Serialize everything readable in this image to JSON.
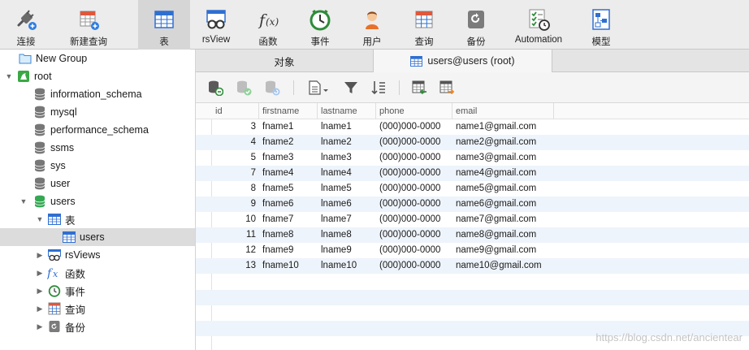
{
  "toolbar": {
    "items": [
      {
        "label": "连接",
        "icon": "connection-plug-icon"
      },
      {
        "label": "新建查询",
        "icon": "new-query-icon"
      },
      {
        "label": "表",
        "icon": "table-icon",
        "active": true
      },
      {
        "label": "rsView",
        "icon": "view-glasses-icon"
      },
      {
        "label": "函数",
        "icon": "function-fx-icon"
      },
      {
        "label": "事件",
        "icon": "event-clock-icon"
      },
      {
        "label": "用户",
        "icon": "user-icon"
      },
      {
        "label": "查询",
        "icon": "query-icon"
      },
      {
        "label": "备份",
        "icon": "backup-icon"
      },
      {
        "label": "Automation",
        "icon": "automation-checklist-icon"
      },
      {
        "label": "模型",
        "icon": "model-icon"
      }
    ]
  },
  "sidebar": {
    "new_group": "New Group",
    "root": "root",
    "databases": [
      "information_schema",
      "mysql",
      "performance_schema",
      "ssms",
      "sys",
      "user",
      "users"
    ],
    "users_children": {
      "tables_label": "表",
      "tables": [
        "users"
      ],
      "views": "rsViews",
      "functions": "函数",
      "events": "事件",
      "queries": "查询",
      "backups": "备份"
    }
  },
  "tabs": {
    "objects": "对象",
    "active": "users@users (root)"
  },
  "grid": {
    "columns": [
      "id",
      "firstname",
      "lastname",
      "phone",
      "email"
    ],
    "rows": [
      [
        "3",
        "fname1",
        "lname1",
        "(000)000-0000",
        "name1@gmail.com"
      ],
      [
        "4",
        "fname2",
        "lname2",
        "(000)000-0000",
        "name2@gmail.com"
      ],
      [
        "5",
        "fname3",
        "lname3",
        "(000)000-0000",
        "name3@gmail.com"
      ],
      [
        "7",
        "fname4",
        "lname4",
        "(000)000-0000",
        "name4@gmail.com"
      ],
      [
        "8",
        "fname5",
        "lname5",
        "(000)000-0000",
        "name5@gmail.com"
      ],
      [
        "9",
        "fname6",
        "lname6",
        "(000)000-0000",
        "name6@gmail.com"
      ],
      [
        "10",
        "fname7",
        "lname7",
        "(000)000-0000",
        "name7@gmail.com"
      ],
      [
        "11",
        "fname8",
        "lname8",
        "(000)000-0000",
        "name8@gmail.com"
      ],
      [
        "12",
        "fname9",
        "lname9",
        "(000)000-0000",
        "name9@gmail.com"
      ],
      [
        "13",
        "fname10",
        "lname10",
        "(000)000-0000",
        "name10@gmail.com"
      ]
    ]
  },
  "watermark": "https://blog.csdn.net/ancientear",
  "colors": {
    "selection": "#dcdcdc",
    "stripe": "#eef4fb",
    "db_active": "#34a853",
    "table_blue": "#2f6fd1"
  }
}
